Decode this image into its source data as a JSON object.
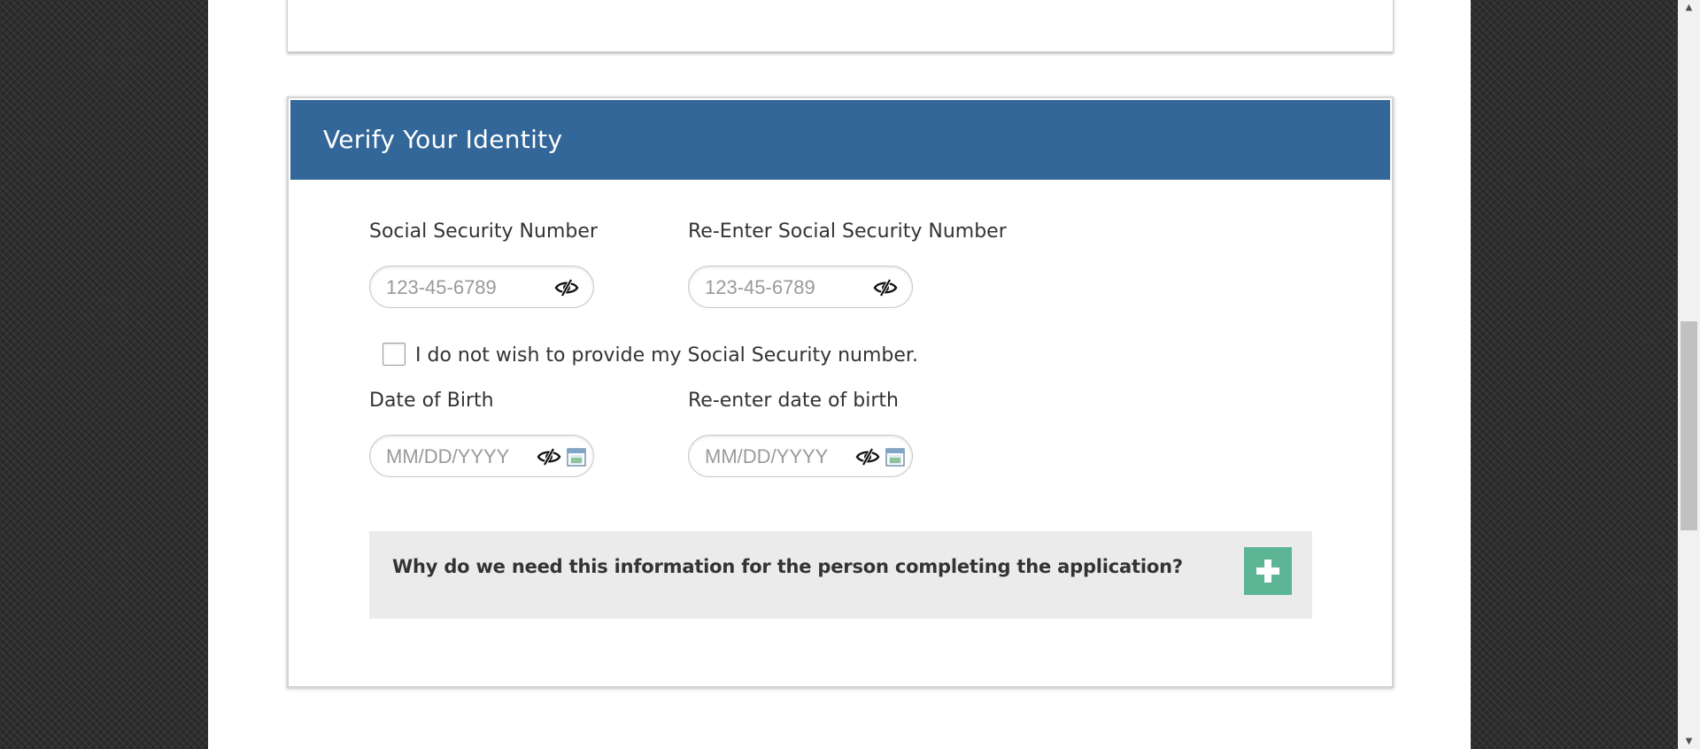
{
  "card": {
    "title": "Verify Your Identity"
  },
  "ssn": {
    "label": "Social Security Number",
    "placeholder": "123-45-6789",
    "value": ""
  },
  "ssn_confirm": {
    "label": "Re-Enter Social Security Number",
    "placeholder": "123-45-6789",
    "value": ""
  },
  "no_ssn": {
    "label": "I do not wish to provide my Social Security number.",
    "checked": false
  },
  "dob": {
    "label": "Date of Birth",
    "placeholder": "MM/DD/YYYY",
    "value": ""
  },
  "dob_confirm": {
    "label": "Re-enter date of birth",
    "placeholder": "MM/DD/YYYY",
    "value": ""
  },
  "info": {
    "question": "Why do we need this information for the person completing the application?"
  },
  "icons": {
    "visibility_toggle": "eye-slash-icon",
    "calendar": "calendar-icon",
    "expand": "plus-icon",
    "scroll_up": "arrow-up-icon",
    "scroll_down": "arrow-down-icon"
  },
  "colors": {
    "header_bg": "#336699",
    "expand_button": "#5cb594",
    "panel_bg": "#ebebeb",
    "background": "#2e2e2e"
  }
}
